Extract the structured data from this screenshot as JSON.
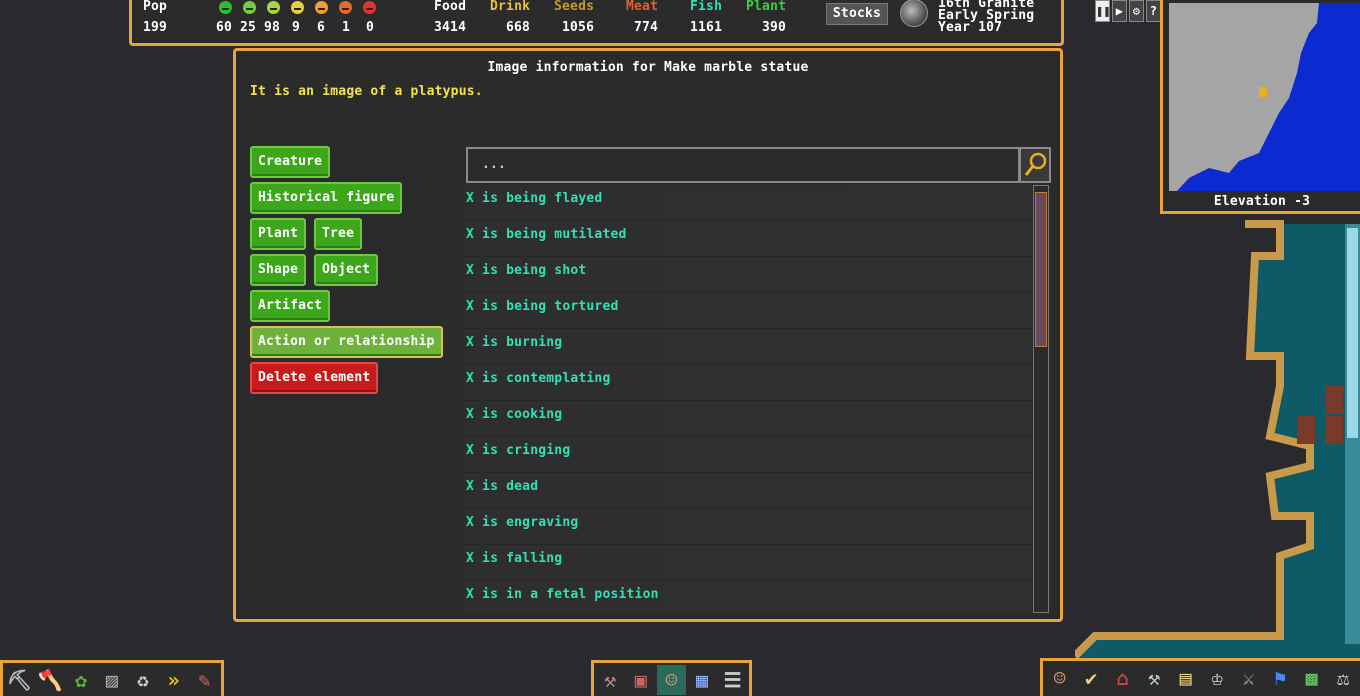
{
  "topbar": {
    "pop_label": "Pop",
    "pop_value": "199",
    "moods": [
      {
        "icon": "ecstatic-face-icon",
        "color": "#2bbf2b",
        "count": "60"
      },
      {
        "icon": "happy-face-icon",
        "color": "#6fd23a",
        "count": "25"
      },
      {
        "icon": "content-face-icon",
        "color": "#a5d63a",
        "count": "98"
      },
      {
        "icon": "fine-face-icon",
        "color": "#e6d23a",
        "count": "9"
      },
      {
        "icon": "stressed-face-icon",
        "color": "#f0a030",
        "count": "6"
      },
      {
        "icon": "haggard-face-icon",
        "color": "#e86a2a",
        "count": "1"
      },
      {
        "icon": "miserable-face-icon",
        "color": "#e83030",
        "count": "0"
      }
    ],
    "stocks": [
      {
        "label": "Food",
        "value": "3414",
        "color": "#ffffff"
      },
      {
        "label": "Drink",
        "value": "668",
        "color": "#e8c23a"
      },
      {
        "label": "Seeds",
        "value": "1056",
        "color": "#c8962a"
      },
      {
        "label": "Meat",
        "value": "774",
        "color": "#e8602a"
      },
      {
        "label": "Fish",
        "value": "1161",
        "color": "#2fe1b5"
      },
      {
        "label": "Plant",
        "value": "390",
        "color": "#3ad23a"
      }
    ],
    "stocks_button": "Stocks",
    "date_line1": "16th Granite",
    "date_line2": "Early Spring",
    "date_line3": "Year 107"
  },
  "controls": [
    "❚❚",
    "▶",
    "⚙",
    "?"
  ],
  "minimap": {
    "elevation": "Elevation -3"
  },
  "dialog": {
    "title": "Image information for Make marble statue",
    "description": "It is an image of a platypus.",
    "categories": {
      "creature": "Creature",
      "historical_figure": "Historical figure",
      "plant": "Plant",
      "tree": "Tree",
      "shape": "Shape",
      "object": "Object",
      "artifact": "Artifact",
      "action": "Action or relationship",
      "delete": "Delete element"
    },
    "search_placeholder": "...",
    "list": [
      "X is being flayed",
      "X is being mutilated",
      "X is being shot",
      "X is being tortured",
      "X is burning",
      "X is contemplating",
      "X is cooking",
      "X is cringing",
      "X is dead",
      "X is engraving",
      "X is falling",
      "X is in a fetal position"
    ]
  },
  "bottom_left_icons": [
    "pickaxe-icon",
    "tree-chop-icon",
    "gather-plants-icon",
    "smooth-icon",
    "dump-icon",
    "fast-forward-icon",
    "erase-icon"
  ],
  "bottom_mid_icons": [
    "build-icon",
    "furniture-icon",
    "citizen-icon",
    "zones-icon",
    "stockpile-icon"
  ],
  "bottom_right_icons": [
    "units-icon",
    "tasks-icon",
    "places-icon",
    "labor-icon",
    "orders-icon",
    "nobles-icon",
    "objects-icon",
    "justice-icon",
    "world-icon",
    "scales-icon"
  ]
}
